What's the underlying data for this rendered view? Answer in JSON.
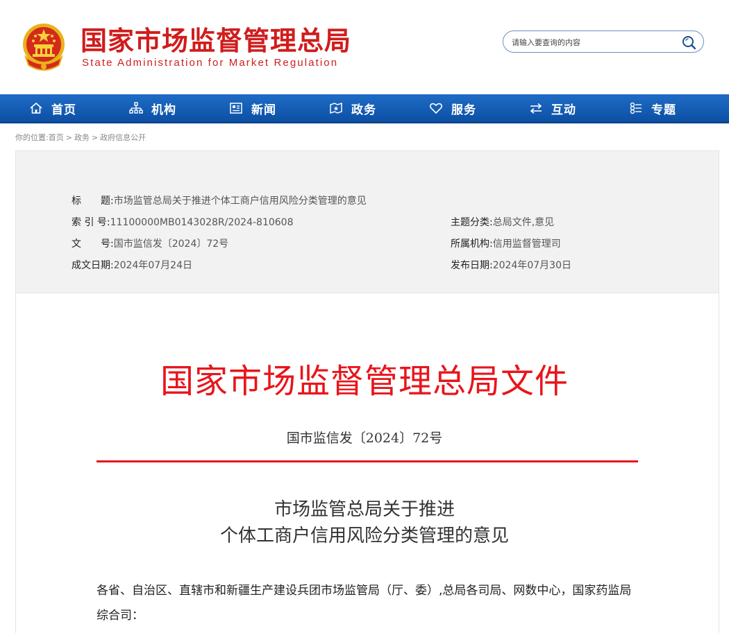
{
  "header": {
    "title": "国家市场监督管理总局",
    "subtitle": "State Administration for Market Regulation",
    "search_placeholder": "请输入要查询的内容"
  },
  "nav": {
    "items": [
      {
        "label": "首页",
        "icon": "home-icon"
      },
      {
        "label": "机构",
        "icon": "org-chart-icon"
      },
      {
        "label": "新闻",
        "icon": "news-icon"
      },
      {
        "label": "政务",
        "icon": "government-affairs-icon"
      },
      {
        "label": "服务",
        "icon": "heart-icon"
      },
      {
        "label": "互动",
        "icon": "exchange-icon"
      },
      {
        "label": "专题",
        "icon": "topics-icon"
      }
    ]
  },
  "breadcrumb": {
    "prefix": "你的位置:",
    "items": [
      "首页",
      "政务",
      "政府信息公开"
    ],
    "separator": ">"
  },
  "meta": {
    "title_label": "标　　题:",
    "title_value": "市场监管总局关于推进个体工商户信用风险分类管理的意见",
    "index_label": "索 引 号:",
    "index_value": "11100000MB0143028R/2024-810608",
    "docno_label": "文　　号:",
    "docno_value": "国市监信发〔2024〕72号",
    "date_label": "成文日期:",
    "date_value": "2024年07月24日",
    "topic_label": "主题分类:",
    "topic_value": "总局文件,意见",
    "dept_label": "所属机构:",
    "dept_value": "信用监督管理司",
    "pub_label": "发布日期:",
    "pub_value": "2024年07月30日"
  },
  "document": {
    "heading": "国家市场监督管理总局文件",
    "number": "国市监信发〔2024〕72号",
    "title_line1": "市场监管总局关于推进",
    "title_line2": "个体工商户信用风险分类管理的意见",
    "salutation": "各省、自治区、直辖市和新疆生产建设兵团市场监管局（厅、委）,总局各司局、网数中心，国家药监局综合司："
  },
  "colors": {
    "brand_red": "#d01c1c",
    "doc_red": "#e8151b",
    "nav_blue": "#1560b8"
  }
}
